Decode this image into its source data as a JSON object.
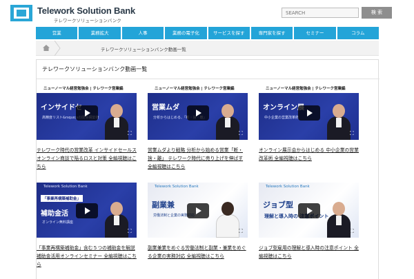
{
  "header": {
    "brand": "Telework Solution Bank",
    "brand_sub": "テレワークソリューションバンク",
    "search_placeholder": "SEARCH",
    "search_button": "検 索"
  },
  "nav": {
    "items": [
      "営業",
      "業務拡大",
      "人事",
      "業務の電子化",
      "サービスを探す",
      "専門家を探す",
      "セミナー",
      "コラム"
    ]
  },
  "breadcrumb": {
    "current": "テレワークソリューションバンク動画一覧"
  },
  "section": {
    "title": "テレワークソリューションバンク動画一覧"
  },
  "videos": [
    {
      "top": "ニューノーマル経営勉強会 | テレワーク営業編",
      "main": "インサイドセ",
      "sub": "高精度リスト&rsquo;sの関係構築術",
      "tagline": "",
      "title": "テレワーク時代の営業改革 インサイドセールス オンライン商談で陥るロスと対策 全編視聴はこちら"
    },
    {
      "top": "ニューノーマル経営勉強会 | テレワーク営業編",
      "main": "営業ムダ",
      "sub": "分析からはじめる、「断・捨・離」",
      "tagline": "",
      "title": "営業ムダより戦略 分析から始める営業「断・捨・離」 テレワーク時代に売り上げを伸ばす 全編視聴はこちら"
    },
    {
      "top": "ニューノーマル経営勉強会 | テレワーク営業編",
      "main": "オンライン展",
      "sub": "中小企業の営業改革術",
      "tagline": "",
      "title": "オンライン展示会からはじめる 中小企業の営業改革術 全編視聴はこちら"
    },
    {
      "top": "Telework Solution Bank",
      "main": "補助金活",
      "sub": "オンライン無料講座",
      "tagline": "「事業再構築補助金」",
      "title": "「事業再構築補助金」含む５つの補助金を解説 補助金活用オンラインセミナー 全編視聴はこちら"
    },
    {
      "top": "Telework Solution Bank",
      "main": "副業兼",
      "sub": "労働法制と企業の実務対応",
      "tagline": "",
      "title": "副業兼業をめぐる労働法制と副業・兼業をめぐる企業の実務対応 全編視聴はこちら"
    },
    {
      "top": "Telework Solution Bank",
      "main": "ジョブ型",
      "sub": "理解と導入時の 注意ポイント",
      "tagline": "",
      "title": "ジョブ型雇用の理解と導入時の注意ポイント 全編視聴はこちら"
    }
  ]
}
